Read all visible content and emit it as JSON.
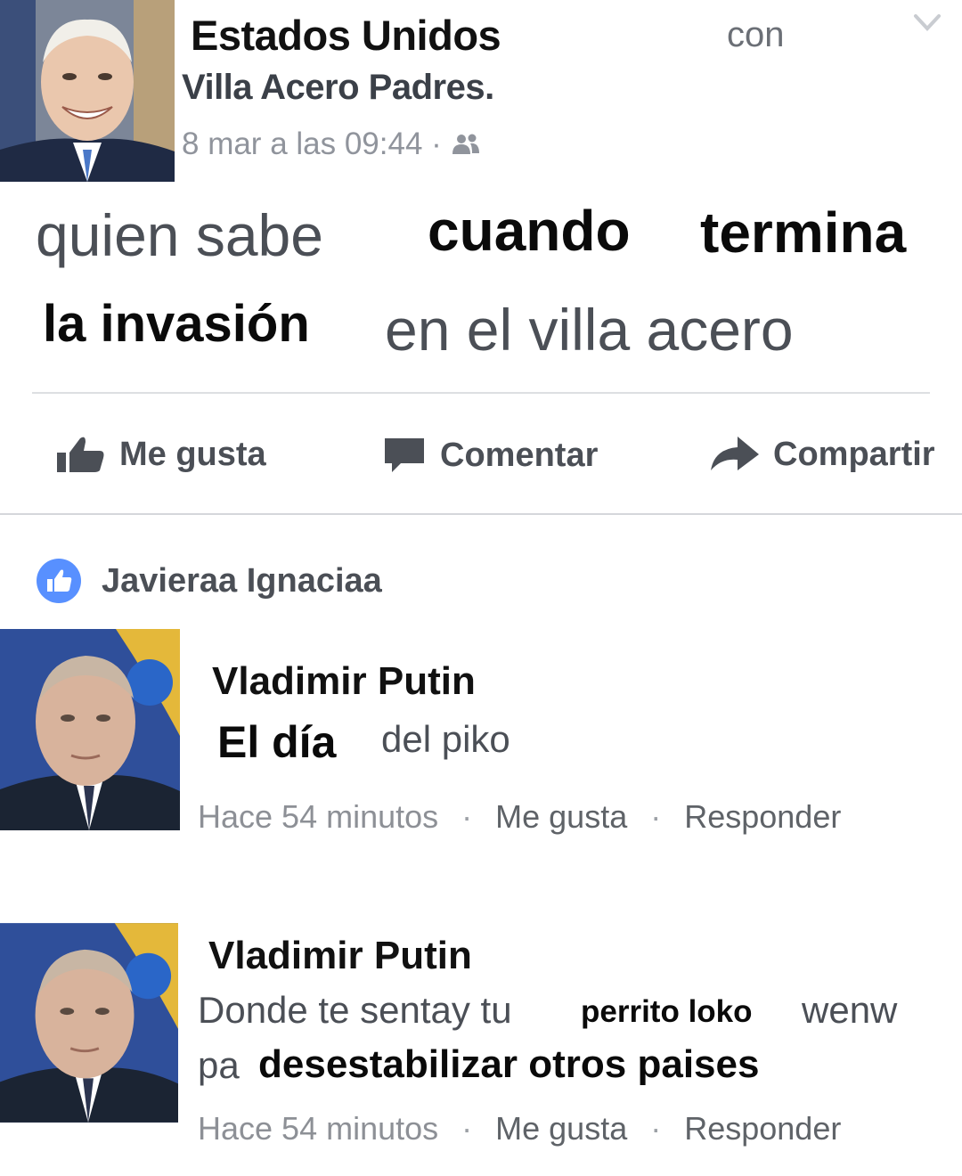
{
  "post": {
    "author": "Estados Unidos",
    "with_label": "con",
    "group": "Villa Acero Padres.",
    "timestamp": "8 mar a las 09:44 ·",
    "audience_icon": "friends-icon",
    "text": {
      "line1": [
        {
          "text": "quien sabe",
          "style": "light"
        },
        {
          "text": "cuando",
          "style": "bold"
        },
        {
          "text": "termina",
          "style": "bold"
        }
      ],
      "line2": [
        {
          "text": "la invasión",
          "style": "bold"
        },
        {
          "text": "en el villa acero",
          "style": "light"
        }
      ]
    },
    "actions": {
      "like": "Me gusta",
      "comment": "Comentar",
      "share": "Compartir"
    }
  },
  "reactions": {
    "name": "Javieraa Ignaciaa"
  },
  "comments": [
    {
      "author": "Vladimir Putin",
      "line1": [
        {
          "text": "El día",
          "style": "bold"
        },
        {
          "text": "del piko",
          "style": "light"
        }
      ],
      "time": "Hace 54 minutos",
      "like": "Me gusta",
      "reply": "Responder"
    },
    {
      "author": "Vladimir Putin",
      "line1": [
        {
          "text": "Donde te sentay tu",
          "style": "light"
        },
        {
          "text": "perrito loko",
          "style": "bold"
        },
        {
          "text": "wenw",
          "style": "light"
        }
      ],
      "line2": [
        {
          "text": "pa",
          "style": "light"
        },
        {
          "text": "desestabilizar otros paises",
          "style": "bold"
        }
      ],
      "time": "Hace 54 minutos",
      "like": "Me gusta",
      "reply": "Responder"
    }
  ],
  "colors": {
    "accent_blue": "#5890ff",
    "meta_gray": "#90949c",
    "action_gray": "#4b4f56"
  }
}
